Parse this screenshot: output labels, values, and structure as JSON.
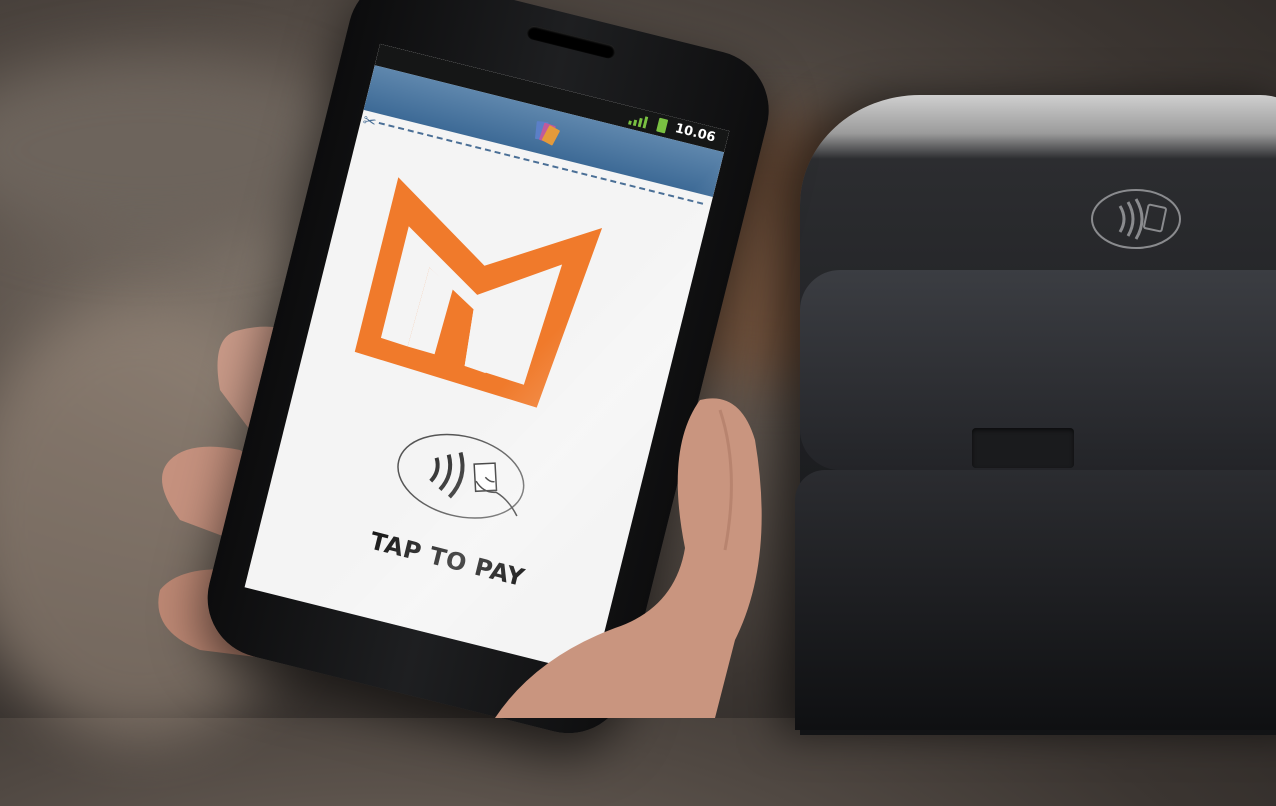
{
  "status_bar": {
    "time": "10.06",
    "signal_icon": "signal-bars-icon",
    "battery_icon": "battery-icon"
  },
  "app_bar": {
    "icon": "wallet-cards-icon"
  },
  "receipt": {
    "scissors_icon": "scissors-icon",
    "logo": "orange-m-brand-logo",
    "contactless_icon": "contactless-tap-icon",
    "action_label": "TAP TO PAY"
  },
  "colors": {
    "brand_orange": "#f07a2b",
    "app_bar_blue": "#4a74a0",
    "battery_green": "#7ac142"
  }
}
